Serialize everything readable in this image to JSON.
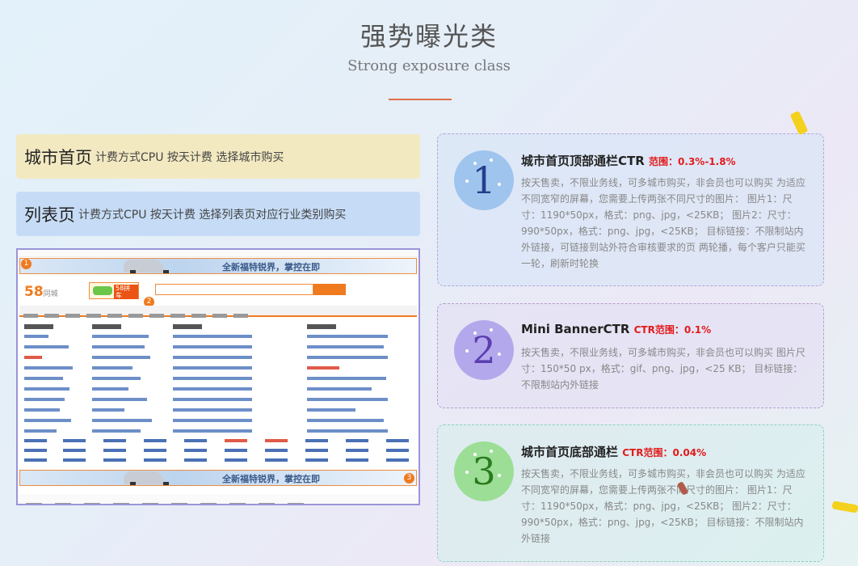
{
  "header": {
    "title": "强势曝光类",
    "subtitle": "Strong exposure class"
  },
  "tags": [
    {
      "big": "城市首页",
      "small": "计费方式CPU 按天计费 选择城市购买"
    },
    {
      "big": "列表页",
      "small": "计费方式CPU 按天计费 选择列表页对应行业类别购买"
    }
  ],
  "screenshot": {
    "banner_text": "全新福特锐界，掌控在即",
    "logo_text": "58",
    "logo_sub": "同城",
    "minibanner_text": "58拼车",
    "markers": [
      "1",
      "2",
      "3"
    ]
  },
  "cards": [
    {
      "number": "1",
      "title": "城市首页顶部通栏CTR",
      "ctr": "范围：0.3%-1.8%",
      "body": "按天售卖，不限业务线，可多城市购买，非会员也可以购买 为适应不同宽窄的屏幕，您需要上传两张不同尺寸的图片： 图片1：尺寸：1190*50px，格式：png、jpg，<25KB； 图片2：尺寸：990*50px，格式：png、jpg，<25KB； 目标链接：不限制站内外链接，可链接到站外符合审核要求的页 两轮播，每个客户只能买一轮，刷新时轮换"
    },
    {
      "number": "2",
      "title": "Mini BannerCTR",
      "ctr": "CTR范围：0.1%",
      "body": "按天售卖，不限业务线，可多城市购买，非会员也可以购买 图片尺寸：150*50 px，格式：gif、png、jpg，<25 KB； 目标链接：不限制站内外链接"
    },
    {
      "number": "3",
      "title": "城市首页底部通栏",
      "ctr": "CTR范围：0.04%",
      "body": "按天售卖，不限业务线，可多城市购买，非会员也可以购买 为适应不同宽窄的屏幕，您需要上传两张不同尺寸的图片： 图片1：尺寸：1190*50px，格式：png、jpg，<25KB； 图片2：尺寸：990*50px，格式：png、jpg，<25KB； 目标链接：不限制站内外链接"
    }
  ],
  "colors": {
    "accent": "#e0704a",
    "ctr_red": "#e21b1b",
    "marker_orange": "#f07a1e"
  }
}
